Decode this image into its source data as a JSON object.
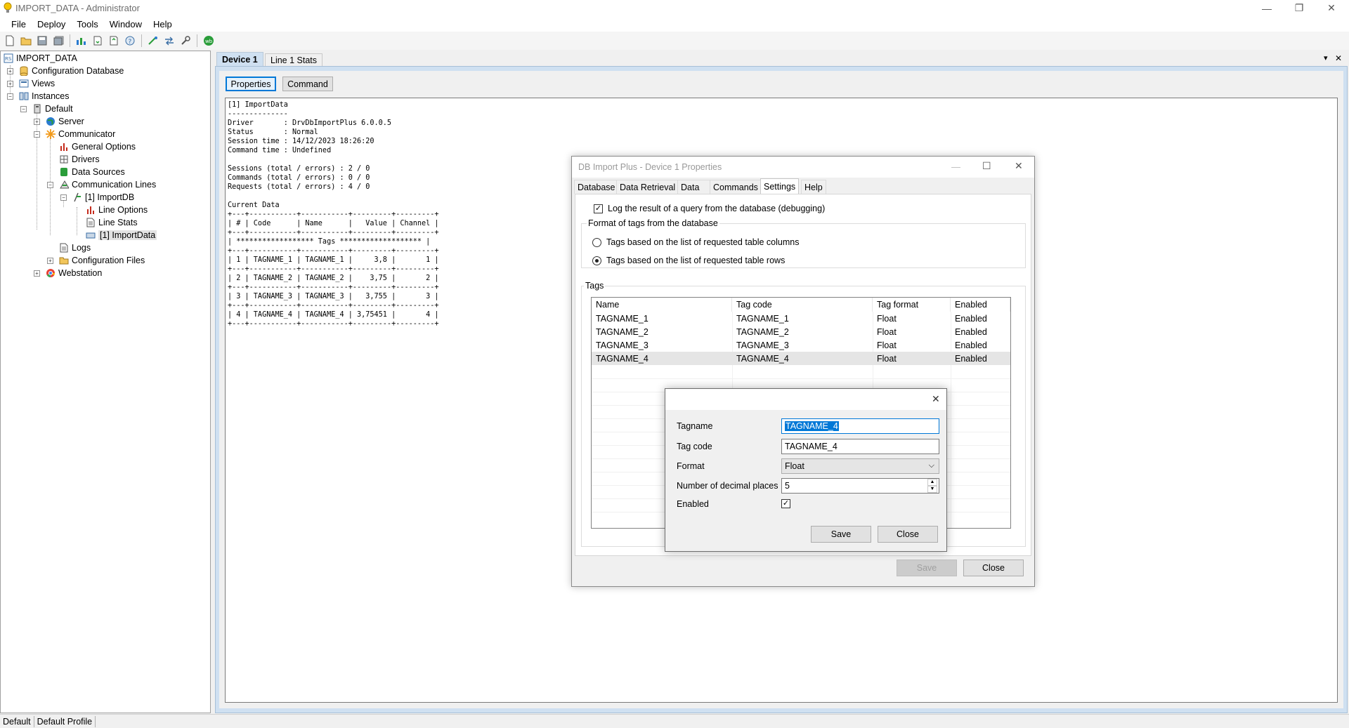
{
  "window": {
    "title": "IMPORT_DATA - Administrator",
    "minimize": "—",
    "restore": "❐",
    "close": "✕"
  },
  "menu": [
    "File",
    "Deploy",
    "Tools",
    "Window",
    "Help"
  ],
  "tree": {
    "root": "IMPORT_DATA",
    "config_db": "Configuration Database",
    "views": "Views",
    "instances": "Instances",
    "default": "Default",
    "server": "Server",
    "communicator": "Communicator",
    "general_options": "General Options",
    "drivers": "Drivers",
    "data_sources": "Data Sources",
    "comm_lines": "Communication Lines",
    "import_db": "[1] ImportDB",
    "line_options": "Line Options",
    "line_stats": "Line Stats",
    "import_data": "[1] ImportData",
    "logs": "Logs",
    "config_files": "Configuration Files",
    "webstation": "Webstation"
  },
  "doc_tabs": [
    "Device 1",
    "Line 1 Stats"
  ],
  "doc_tab_icons": {
    "dropdown": "▾",
    "close": "✕"
  },
  "panel_buttons": {
    "properties": "Properties",
    "command": "Command"
  },
  "console_text": "[1] ImportData\n--------------\nDriver       : DrvDbImportPlus 6.0.0.5\nStatus       : Normal\nSession time : 14/12/2023 18:26:20\nCommand time : Undefined\n\nSessions (total / errors) : 2 / 0\nCommands (total / errors) : 0 / 0\nRequests (total / errors) : 4 / 0\n\nCurrent Data\n+---+-----------+-----------+---------+---------+\n| # | Code      | Name      |   Value | Channel |\n+---+-----------+-----------+---------+---------+\n| ****************** Tags ******************* |\n+---+-----------+-----------+---------+---------+\n| 1 | TAGNAME_1 | TAGNAME_1 |     3,8 |       1 |\n+---+-----------+-----------+---------+---------+\n| 2 | TAGNAME_2 | TAGNAME_2 |    3,75 |       2 |\n+---+-----------+-----------+---------+---------+\n| 3 | TAGNAME_3 | TAGNAME_3 |   3,755 |       3 |\n+---+-----------+-----------+---------+---------+\n| 4 | TAGNAME_4 | TAGNAME_4 | 3,75451 |       4 |\n+---+-----------+-----------+---------+---------+",
  "props_dialog": {
    "title": "DB Import Plus - Device 1 Properties",
    "tabs": [
      "Database",
      "Data Retrieval",
      "Data",
      "Commands",
      "Settings",
      "Help"
    ],
    "log_checkbox_label": "Log the result of a query from the database (debugging)",
    "format_group": "Format of tags from the database",
    "radio_columns": "Tags based on the list of requested table columns",
    "radio_rows": "Tags based on the list of requested table rows",
    "tags_group": "Tags",
    "columns": [
      "Name",
      "Tag code",
      "Tag format",
      "Enabled"
    ],
    "rows": [
      [
        "TAGNAME_1",
        "TAGNAME_1",
        "Float",
        "Enabled"
      ],
      [
        "TAGNAME_2",
        "TAGNAME_2",
        "Float",
        "Enabled"
      ],
      [
        "TAGNAME_3",
        "TAGNAME_3",
        "Float",
        "Enabled"
      ],
      [
        "TAGNAME_4",
        "TAGNAME_4",
        "Float",
        "Enabled"
      ]
    ],
    "save": "Save",
    "close": "Close"
  },
  "edit_dialog": {
    "close_icon": "✕",
    "tagname_label": "Tagname",
    "tagname_value": "TAGNAME_4",
    "tagcode_label": "Tag code",
    "tagcode_value": "TAGNAME_4",
    "format_label": "Format",
    "format_value": "Float",
    "decimals_label": "Number of decimal places",
    "decimals_value": "5",
    "enabled_label": "Enabled",
    "save": "Save",
    "close": "Close"
  },
  "status": [
    "Default",
    "Default Profile"
  ],
  "colors": {
    "accent": "#0078d7",
    "doc_border": "#cfe0f1"
  }
}
